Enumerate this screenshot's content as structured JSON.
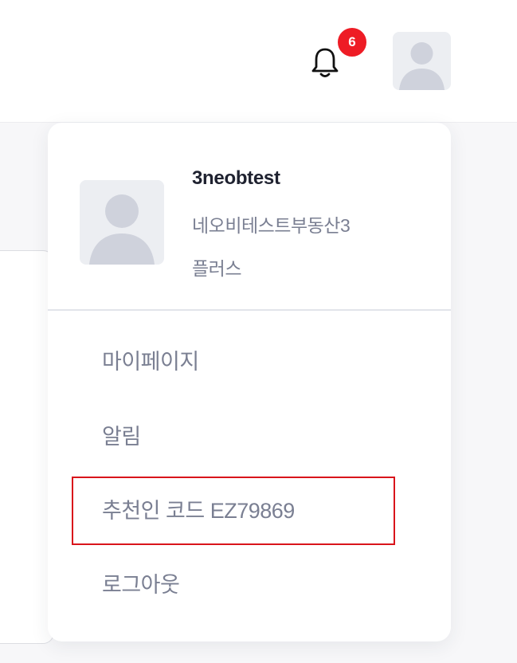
{
  "header": {
    "notification_count": "6",
    "bell_icon": "bell-icon",
    "avatar_icon": "user-avatar-icon"
  },
  "profile": {
    "username": "3neobtest",
    "company": "네오비테스트부동산3",
    "plan": "플러스"
  },
  "menu": {
    "items": [
      {
        "label": "마이페이지"
      },
      {
        "label": "알림"
      },
      {
        "label": "추천인 코드 EZ79869"
      },
      {
        "label": "로그아웃"
      }
    ]
  },
  "colors": {
    "badge": "#ee1c25",
    "highlight_border": "#d9141b",
    "menu_text": "#7a7f92",
    "username_text": "#1f2230"
  }
}
